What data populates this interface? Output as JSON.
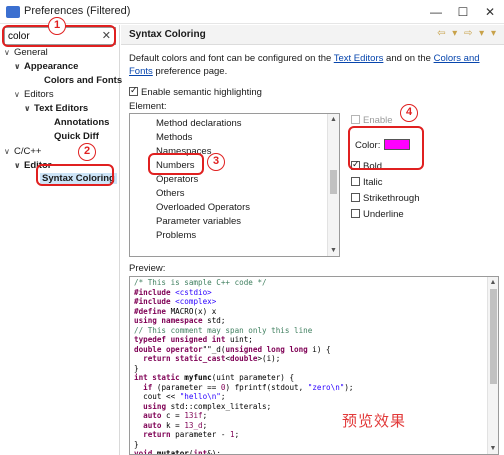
{
  "window": {
    "title": "Preferences (Filtered)",
    "icon_text": "",
    "min": "—",
    "max": "☐",
    "close": "✕"
  },
  "filter": {
    "value": "color",
    "clear": "✕"
  },
  "tree": [
    {
      "label": "General",
      "arrow": "∨",
      "bold": false
    },
    {
      "label": "Appearance",
      "arrow": "∨",
      "bold": true
    },
    {
      "label": "Colors and Fonts",
      "arrow": "",
      "bold": true
    },
    {
      "label": "Editors",
      "arrow": "∨",
      "bold": false
    },
    {
      "label": "Text Editors",
      "arrow": "∨",
      "bold": true
    },
    {
      "label": "Annotations",
      "arrow": "",
      "bold": true
    },
    {
      "label": "Quick Diff",
      "arrow": "",
      "bold": true
    },
    {
      "label": "C/C++",
      "arrow": "∨",
      "bold": false
    },
    {
      "label": "Editor",
      "arrow": "∨",
      "bold": true
    },
    {
      "label": "Syntax Coloring",
      "arrow": "",
      "bold": true
    }
  ],
  "page": {
    "title": "Syntax Coloring",
    "nav": "⇦ ▾ ⇨ ▾ ▾",
    "desc_prefix": "Default colors and font can be configured on the ",
    "desc_link1": "Text Editors",
    "desc_mid": " and on the ",
    "desc_link2": "Colors and Fonts",
    "desc_suffix": " preference page.",
    "semantic_label": "Enable semantic highlighting",
    "element_label": "Element:",
    "preview_label": "Preview:"
  },
  "elements": [
    "Method declarations",
    "Methods",
    "Namespaces",
    "Numbers",
    "Operators",
    "Others",
    "Overloaded Operators",
    "Parameter variables",
    "Problems"
  ],
  "options": {
    "enable": "Enable",
    "color": "Color:",
    "color_value": "#ff00ff",
    "bold": "Bold",
    "italic": "Italic",
    "strikethrough": "Strikethrough",
    "underline": "Underline"
  },
  "preview_caption": "预览效果",
  "annotations": [
    "1",
    "2",
    "3",
    "4"
  ]
}
